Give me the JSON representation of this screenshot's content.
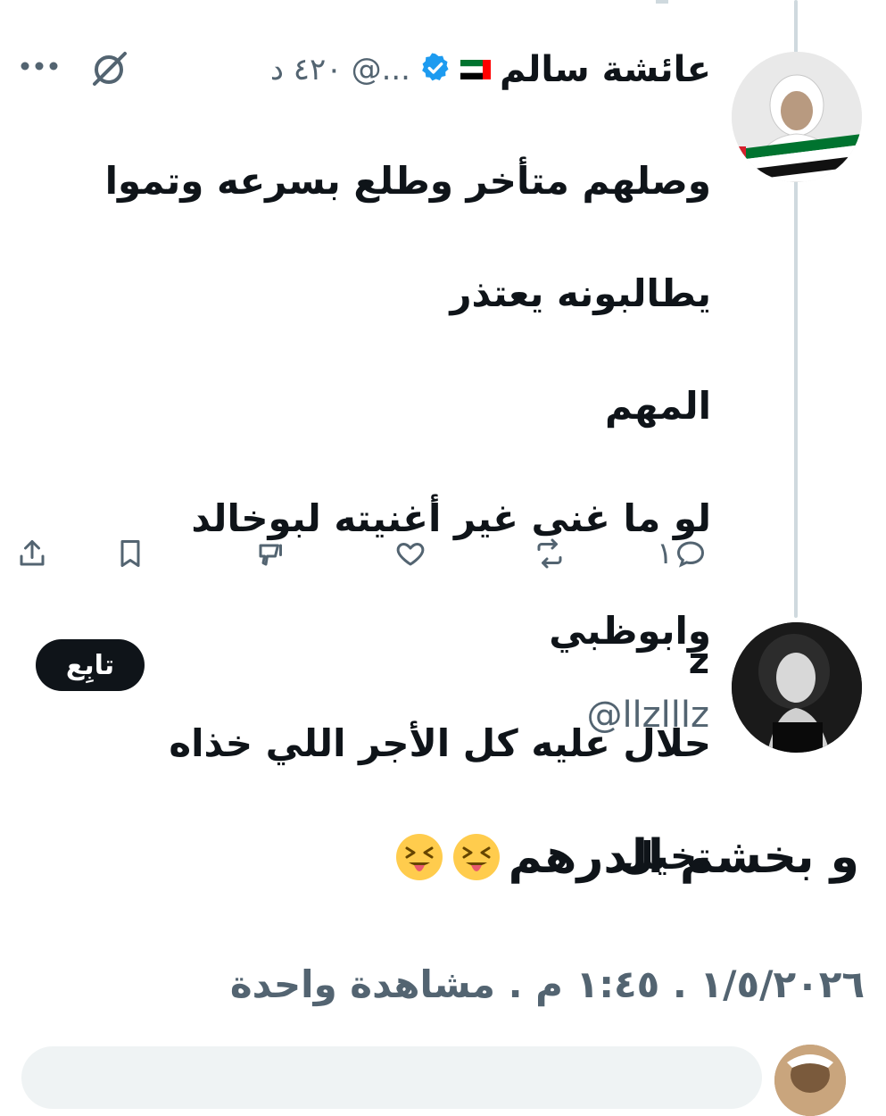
{
  "tweet1": {
    "name": "عائشة سالم",
    "handle": "@...",
    "time": "٤٢٠ د",
    "text_lines": [
      "وصلهم متأخر وطلع بسرعه وتموا",
      "يطالبونه يعتذر",
      "المهم",
      "لو ما غنى غير أغنيته لبوخالد",
      "وابوظبي",
      "حلال عليه كل الأجر اللي خذاه",
      "تخيل"
    ],
    "reply_count": "١",
    "flag_icon": "uae-flag-icon",
    "verified_icon": "verified-badge-icon",
    "colors": {
      "verified": "#1d9bf0",
      "text": "#0f1419",
      "muted": "#536471"
    }
  },
  "actions": {
    "reply_icon": "reply-icon",
    "retweet_icon": "retweet-icon",
    "like_icon": "heart-icon",
    "views_icon": "views-icon",
    "bookmark_icon": "bookmark-icon",
    "share_icon": "share-icon"
  },
  "tweet2": {
    "follow_label": "تابِع",
    "name": "z",
    "handle": "@llzlllz",
    "text": "و بخشم الدرهم",
    "emoji_icon": "squinting-face-with-tongue-emoji",
    "meta": "١/٥/٢٠٢٦ . ١:٤٥ م . مشاهدة واحدة"
  }
}
